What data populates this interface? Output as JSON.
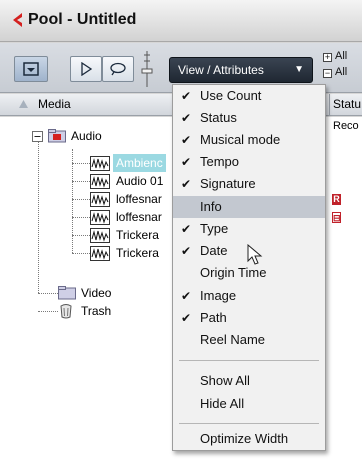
{
  "window": {
    "title": "Pool - Untitled"
  },
  "toolbar": {
    "view_button_label": "View / Attributes",
    "right_options": [
      {
        "box": "+",
        "label": "All"
      },
      {
        "box": "−",
        "label": "All"
      }
    ]
  },
  "columns": {
    "media": "Media",
    "status": "Statu"
  },
  "tree": {
    "media_folder": "Audio",
    "audio_items": [
      "Ambienc",
      "Audio 01",
      "loffesnar",
      "loffesnar",
      "Trickera",
      "Trickera"
    ],
    "video_folder": "Video",
    "trash_folder": "Trash",
    "status_text": "Reco",
    "status_badges": [
      "R",
      "⊟"
    ]
  },
  "menu": {
    "items": [
      {
        "label": "Use Count",
        "checked": true
      },
      {
        "label": "Status",
        "checked": true
      },
      {
        "label": "Musical mode",
        "checked": true
      },
      {
        "label": "Tempo",
        "checked": true
      },
      {
        "label": "Signature",
        "checked": true
      },
      {
        "label": "Info",
        "checked": false,
        "hover": true
      },
      {
        "label": "Type",
        "checked": true
      },
      {
        "label": "Date",
        "checked": true
      },
      {
        "label": "Origin Time",
        "checked": false
      },
      {
        "label": "Image",
        "checked": true
      },
      {
        "label": "Path",
        "checked": true
      },
      {
        "label": "Reel Name",
        "checked": false
      }
    ],
    "actions": [
      "Show All",
      "Hide All"
    ],
    "optimize": "Optimize Width",
    "check_glyph": "✔"
  },
  "colors": {
    "highlight": "#9bd9e2",
    "menu_hover": "#c3c8d0",
    "view_button": "#2a3340",
    "badge_red": "#c0212a"
  }
}
